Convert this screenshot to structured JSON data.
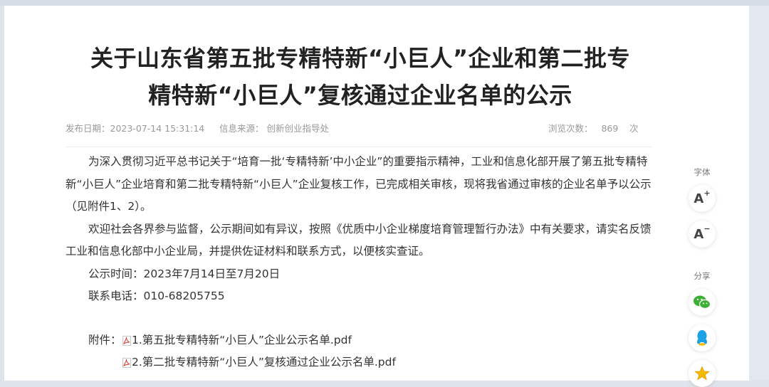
{
  "article": {
    "title_line1": "关于山东省第五批专精特新“小巨人”企业和第二批专",
    "title_line2": "精特新“小巨人”复核通过企业名单的公示",
    "meta": {
      "publish_date": "发布日期：2023-07-14 15:31:14",
      "source": "信息来源：  创新创业指导处",
      "views_label": "浏览次数：",
      "views_count": "869",
      "views_unit": "次"
    },
    "paragraph1": "为深入贯彻习近平总书记关于“培育一批‘专精特新’中小企业”的重要指示精神，工业和信息化部开展了第五批专精特新“小巨人”企业培育和第二批专精特新“小巨人”企业复核工作，已完成相关审核，现将我省通过审核的企业名单予以公示（见附件1、2）。",
    "paragraph2": "欢迎社会各界参与监督，公示期间如有异议，按照《优质中小企业梯度培育管理暂行办法》中有关要求，请实名反馈工业和信息化部中小企业局，并提供佐证材料和联系方式，以便核实查证。",
    "period": "公示时间：2023年7月14日至7月20日",
    "phone": "联系电话：010-68205755",
    "attachments_label": "附件：",
    "attachments": [
      "1.第五批专精特新“小巨人”企业公示名单.pdf",
      "2.第二批专精特新“小巨人”复核通过企业公示名单.pdf"
    ]
  },
  "sidebar": {
    "font_label": "字体",
    "font_increase": "A",
    "font_decrease": "A",
    "share_label": "分享",
    "icons": [
      "font-increase-icon",
      "font-decrease-icon",
      "wechat-icon",
      "qq-icon",
      "favorite-star-icon"
    ]
  },
  "colors": {
    "wechat": "#3cb034",
    "qq": "#1aa1e6",
    "star": "#f5b800",
    "pdf": "#d23a2c"
  }
}
